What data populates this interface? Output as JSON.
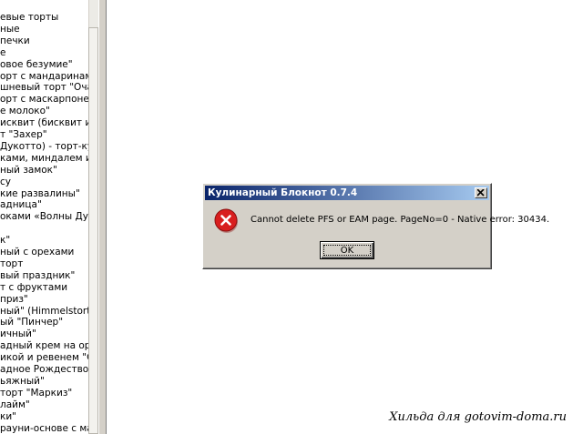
{
  "recipe_list": {
    "items": [
      "евые торты",
      "ные",
      " печки",
      "е",
      "овое безумие\"",
      "орт с мандаринами",
      "шневый торт \"Оча",
      "орт с маскарпоне",
      "е молоко\"",
      "исквит (бисквит из",
      "т \"Захер\"",
      "Дукотто) - торт-куп",
      "ками, миндалем и ц",
      "ный замок\"",
      "су",
      "кие развалины\"",
      "адница\"",
      "оками «Волны Дун",
      "",
      "к\"",
      "ный с орехами",
      " торт",
      "вый праздник\"",
      "т с фруктами",
      "приз\"",
      "ный\" (Himmelstorte",
      "ый \"Пинчер\"",
      "ичный\"",
      "адный крем на оре",
      "икой и ревенем \"Сл",
      "адное Рождество\"",
      "ьяжный\"",
      " торт \"Маркиз\"",
      "лайм\"",
      "ки\"",
      "рауни-основе с ма"
    ]
  },
  "dialog": {
    "title": "Кулинарный Блокнот 0.7.4",
    "message": "Cannot delete PFS or EAM page. PageNo=0 - Native error: 30434.",
    "ok_label": "OK",
    "icon": "error-icon"
  },
  "watermark": "Хильда для gotovim-doma.ru",
  "colors": {
    "titlebar_start": "#0a246a",
    "titlebar_end": "#a6caf0",
    "dialog_face": "#d4d0c8",
    "error_red": "#d81e1e"
  }
}
